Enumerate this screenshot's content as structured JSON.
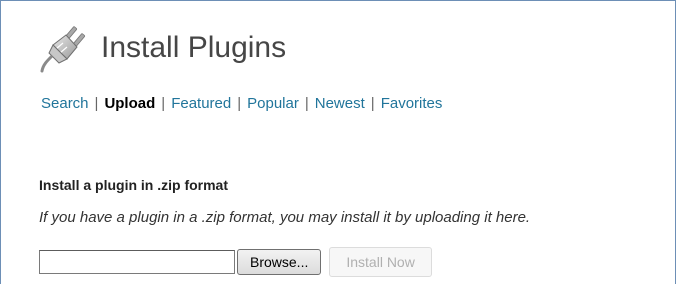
{
  "header": {
    "title": "Install Plugins",
    "icon": "plugin-plug-icon"
  },
  "nav": {
    "items": [
      {
        "label": "Search",
        "current": false
      },
      {
        "label": "Upload",
        "current": true
      },
      {
        "label": "Featured",
        "current": false
      },
      {
        "label": "Popular",
        "current": false
      },
      {
        "label": "Newest",
        "current": false
      },
      {
        "label": "Favorites",
        "current": false
      }
    ],
    "separator": "|"
  },
  "upload": {
    "heading": "Install a plugin in .zip format",
    "description": "If you have a plugin in a .zip format, you may install it by uploading it here.",
    "file_value": "",
    "browse_label": "Browse...",
    "install_label": "Install Now"
  },
  "colors": {
    "link": "#21759b",
    "current": "#000000",
    "frame_border": "#6d8fb6",
    "disabled_text": "#b0b0b0"
  }
}
